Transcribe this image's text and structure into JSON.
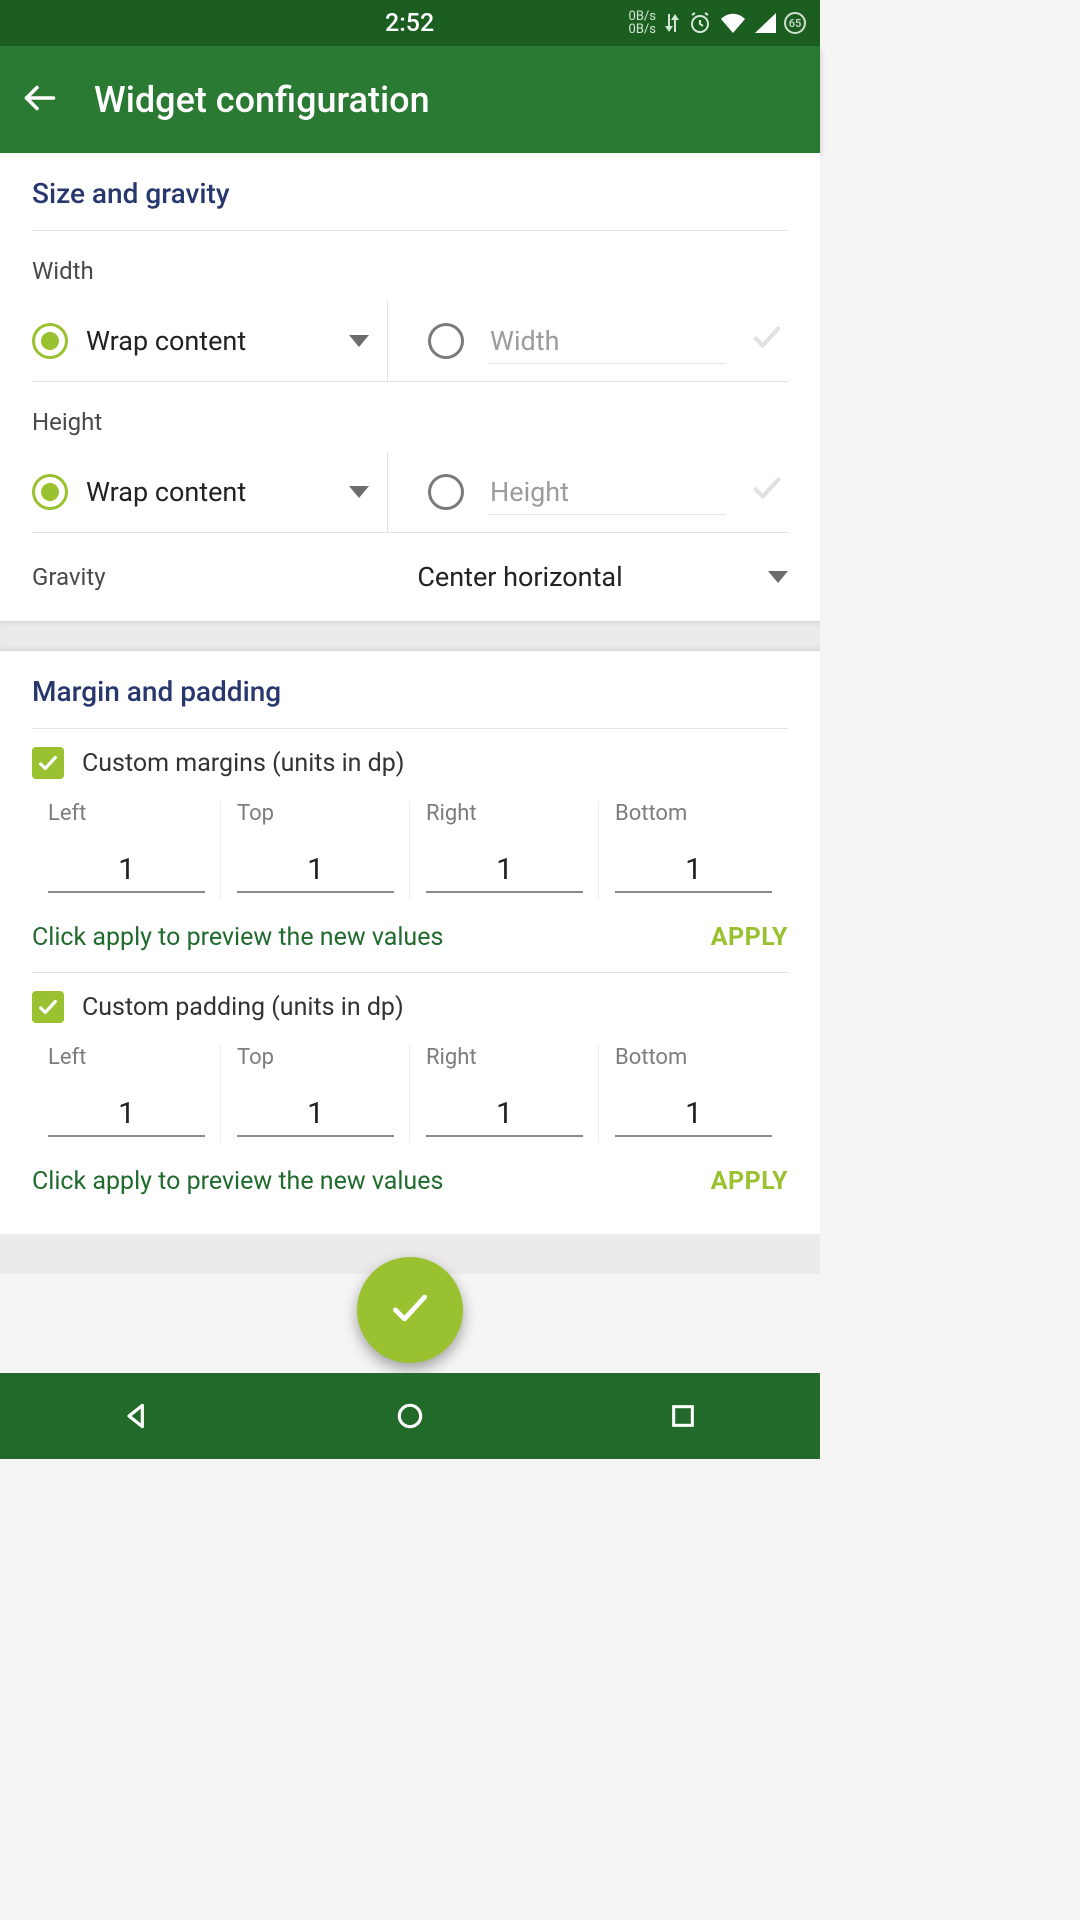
{
  "status": {
    "time": "2:52",
    "net_rate_up": "0B/s",
    "net_rate_down": "0B/s",
    "battery": "65"
  },
  "appbar": {
    "title": "Widget configuration"
  },
  "size_gravity": {
    "title": "Size and gravity",
    "width_label": "Width",
    "width_value": "Wrap content",
    "width_placeholder": "Width",
    "height_label": "Height",
    "height_value": "Wrap content",
    "height_placeholder": "Height",
    "gravity_label": "Gravity",
    "gravity_value": "Center horizontal"
  },
  "margin_padding": {
    "title": "Margin and padding",
    "margins_label": "Custom margins (units in dp)",
    "padding_label": "Custom padding (units in dp)",
    "cols": {
      "left": "Left",
      "top": "Top",
      "right": "Right",
      "bottom": "Bottom"
    },
    "margins": {
      "left": "1",
      "top": "1",
      "right": "1",
      "bottom": "1"
    },
    "padding": {
      "left": "1",
      "top": "1",
      "right": "1",
      "bottom": "1"
    },
    "hint": "Click apply to preview the new values",
    "apply": "APPLY"
  }
}
